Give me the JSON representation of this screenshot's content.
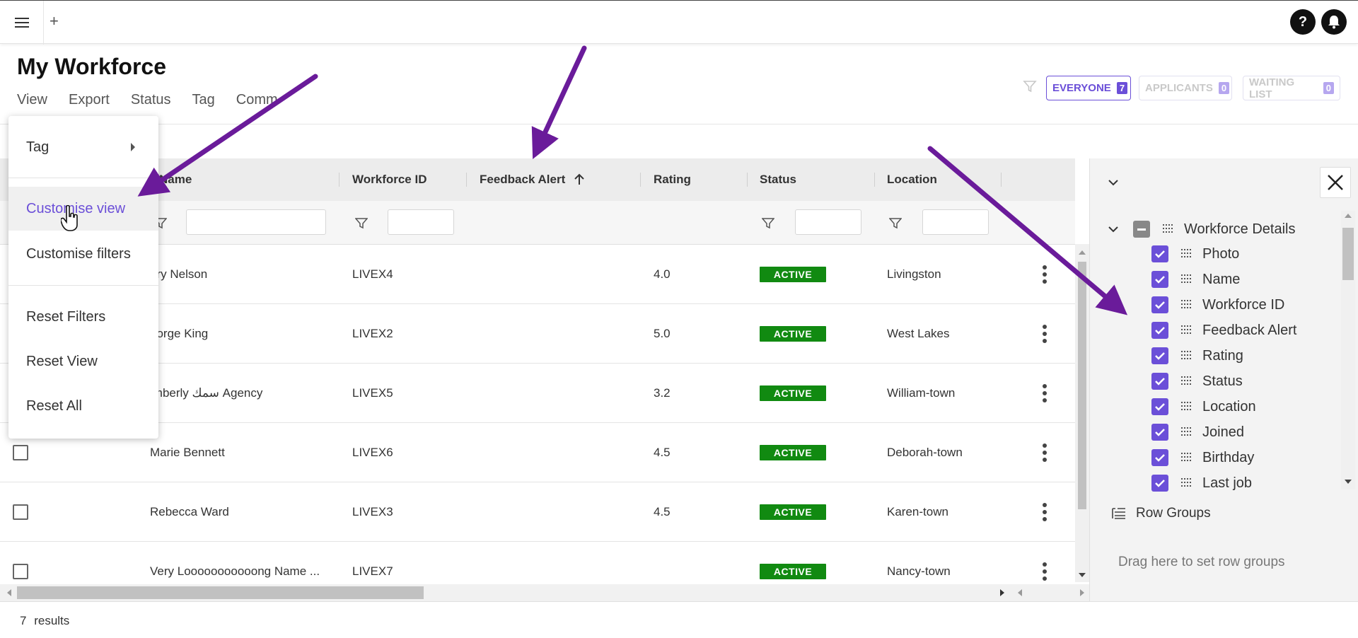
{
  "header": {
    "page_title": "My Workforce",
    "menu": [
      "View",
      "Export",
      "Status",
      "Tag",
      "Comm"
    ],
    "segments": [
      {
        "label": "EVERYONE",
        "count": "7"
      },
      {
        "label": "APPLICANTS",
        "count": "0"
      },
      {
        "label": "WAITING LIST",
        "count": "0"
      }
    ],
    "add_tab": "+",
    "help_icon": "?"
  },
  "dropdown": {
    "items": [
      "Tag",
      "Customise view",
      "Customise filters",
      "Reset Filters",
      "Reset View",
      "Reset All"
    ]
  },
  "grid": {
    "columns": [
      "Name",
      "Workforce ID",
      "Feedback Alert",
      "Rating",
      "Status",
      "Location"
    ],
    "sorted_column": "Feedback Alert",
    "rows": [
      {
        "name": "ary Nelson",
        "id": "LIVEX4",
        "rating": "4.0",
        "status": "ACTIVE",
        "location": "Livingston"
      },
      {
        "name": "eorge King",
        "id": "LIVEX2",
        "rating": "5.0",
        "status": "ACTIVE",
        "location": "West Lakes"
      },
      {
        "name": "imberly سمك Agency",
        "id": "LIVEX5",
        "rating": "3.2",
        "status": "ACTIVE",
        "location": "William-town"
      },
      {
        "name": "Marie Bennett",
        "id": "LIVEX6",
        "rating": "4.5",
        "status": "ACTIVE",
        "location": "Deborah-town"
      },
      {
        "name": "Rebecca Ward",
        "id": "LIVEX3",
        "rating": "4.5",
        "status": "ACTIVE",
        "location": "Karen-town"
      },
      {
        "name": "Very Looooooooooong Name ...",
        "id": "LIVEX7",
        "rating": "",
        "status": "ACTIVE",
        "location": "Nancy-town"
      }
    ]
  },
  "side_panel": {
    "group_label": "Workforce Details",
    "columns": [
      "Photo",
      "Name",
      "Workforce ID",
      "Feedback Alert",
      "Rating",
      "Status",
      "Location",
      "Joined",
      "Birthday",
      "Last job"
    ],
    "row_groups_label": "Row Groups",
    "row_groups_hint": "Drag here to set row groups"
  },
  "footer": {
    "count": "7",
    "results_label": "results"
  },
  "colors": {
    "accent": "#6b4fd8",
    "status_active": "#118a11",
    "annotation_arrow": "#6a1b9a"
  }
}
